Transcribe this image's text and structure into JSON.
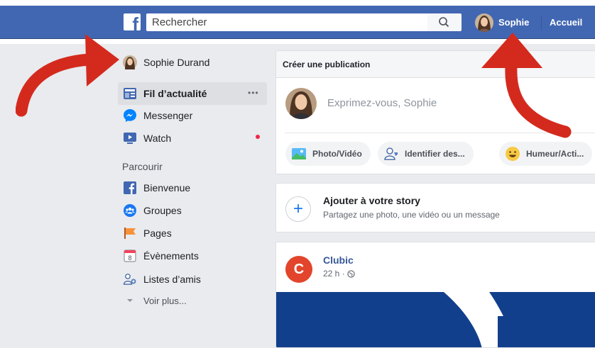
{
  "topbar": {
    "logo_letter": "f",
    "search_placeholder": "Rechercher",
    "user_name": "Sophie",
    "home_label": "Accueil"
  },
  "sidebar": {
    "profile_name": "Sophie Durand",
    "items": [
      {
        "label": "Fil d’actualité",
        "icon": "news-feed-icon"
      },
      {
        "label": "Messenger",
        "icon": "messenger-icon"
      },
      {
        "label": "Watch",
        "icon": "watch-icon"
      }
    ],
    "more_dots": "•••",
    "section_title": "Parcourir",
    "explore": [
      {
        "label": "Bienvenue",
        "icon": "facebook-icon"
      },
      {
        "label": "Groupes",
        "icon": "groups-icon"
      },
      {
        "label": "Pages",
        "icon": "pages-flag-icon"
      },
      {
        "label": "Évènements",
        "icon": "calendar-icon",
        "day": "8"
      },
      {
        "label": "Listes d’amis",
        "icon": "friends-list-icon"
      }
    ],
    "see_more": "Voir plus..."
  },
  "composer": {
    "title": "Créer une publication",
    "placeholder": "Exprimez-vous, Sophie",
    "actions": [
      "Photo/Vidéo",
      "Identifier des...",
      "Humeur/Acti..."
    ]
  },
  "story": {
    "title": "Ajouter à votre story",
    "subtitle": "Partagez une photo, une vidéo ou un message"
  },
  "post": {
    "page_initial": "C",
    "page_name": "Clubic",
    "time": "22 h ·"
  },
  "colors": {
    "brand_blue": "#4267b2",
    "annotation_red": "#d42a1e",
    "clubic_red": "#e2452b"
  }
}
